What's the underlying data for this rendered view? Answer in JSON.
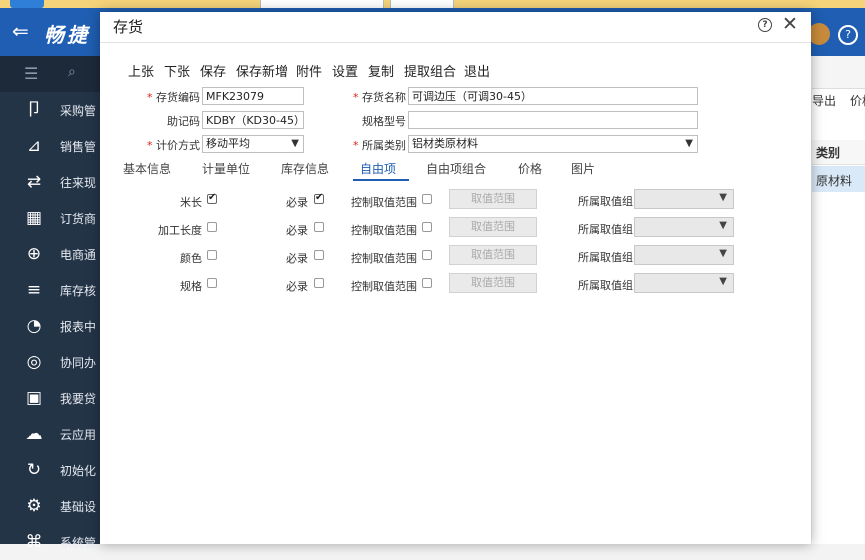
{
  "app": {
    "brand": "畅捷",
    "back_icon": "arrow-left-icon",
    "sidebar": [
      {
        "icon": "purchase-icon",
        "label": "采购管"
      },
      {
        "icon": "sales-icon",
        "label": "销售管"
      },
      {
        "icon": "transfer-icon",
        "label": "往来现"
      },
      {
        "icon": "order-icon",
        "label": "订货商"
      },
      {
        "icon": "ecommerce-icon",
        "label": "电商通"
      },
      {
        "icon": "inventory-icon",
        "label": "库存核"
      },
      {
        "icon": "report-icon",
        "label": "报表中"
      },
      {
        "icon": "collab-icon",
        "label": "协同办"
      },
      {
        "icon": "loan-icon",
        "label": "我要贷"
      },
      {
        "icon": "cloud-icon",
        "label": "云应用"
      },
      {
        "icon": "init-icon",
        "label": "初始化"
      },
      {
        "icon": "settings-icon",
        "label": "基础设"
      },
      {
        "icon": "system-icon",
        "label": "系统管"
      }
    ],
    "bg_toolbar": [
      "导出",
      "价格"
    ],
    "bg_table": {
      "header": "类别",
      "row": "原材料"
    }
  },
  "dialog": {
    "title": "存货",
    "toolbar": [
      "上张",
      "下张",
      "保存",
      "保存新增",
      "附件",
      "设置",
      "复制",
      "提取组合",
      "退出"
    ],
    "fields": {
      "code_label": "存货编码",
      "code_value": "MFK23079",
      "name_label": "存货名称",
      "name_value": "可调边压（可调30-45）",
      "mnemonic_label": "助记码",
      "mnemonic_value": "KDBY（KD30-45）",
      "spec_label": "规格型号",
      "spec_value": "",
      "pricing_label": "计价方式",
      "pricing_value": "移动平均",
      "category_label": "所属类别",
      "category_value": "铝材类原材料"
    },
    "tabs": [
      "基本信息",
      "计量单位",
      "库存信息",
      "自由项",
      "自由项组合",
      "价格",
      "图片"
    ],
    "active_tab": "自由项",
    "free_items": [
      {
        "name": "米长",
        "checked": true,
        "required_label": "必录",
        "required": true,
        "range_label": "控制取值范围",
        "range_button": "取值范围",
        "group_label": "所属取值组"
      },
      {
        "name": "加工长度",
        "checked": false,
        "required_label": "必录",
        "required": false,
        "range_label": "控制取值范围",
        "range_button": "取值范围",
        "group_label": "所属取值组"
      },
      {
        "name": "颜色",
        "checked": false,
        "required_label": "必录",
        "required": false,
        "range_label": "控制取值范围",
        "range_button": "取值范围",
        "group_label": "所属取值组"
      },
      {
        "name": "规格",
        "checked": false,
        "required_label": "必录",
        "required": false,
        "range_label": "控制取值范围",
        "range_button": "取值范围",
        "group_label": "所属取值组"
      }
    ]
  }
}
